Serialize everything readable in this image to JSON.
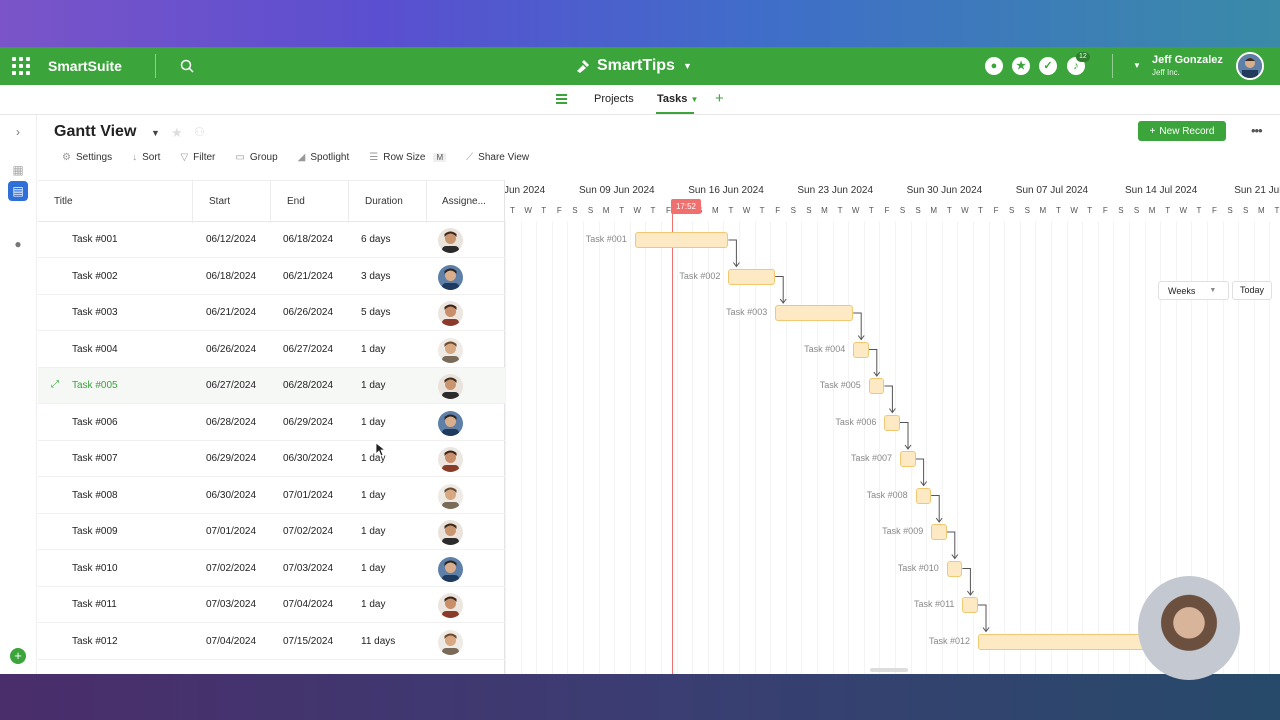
{
  "app": {
    "brand": "SmartSuite",
    "workspace": "SmartTips",
    "notification_count": "12",
    "user": {
      "name": "Jeff Gonzalez",
      "org": "Jeff Inc."
    }
  },
  "subnav": {
    "tabs": [
      {
        "label": "Projects"
      },
      {
        "label": "Tasks"
      }
    ]
  },
  "view": {
    "title": "Gantt View",
    "new_record_label": "New Record",
    "toolbar": {
      "settings": "Settings",
      "sort": "Sort",
      "filter": "Filter",
      "group": "Group",
      "spotlight": "Spotlight",
      "row_size": "Row Size",
      "row_size_value": "M",
      "share_view": "Share View"
    }
  },
  "grid": {
    "columns": [
      "Title",
      "Start",
      "End",
      "Duration",
      "Assigne..."
    ],
    "rows": [
      {
        "title": "Task #001",
        "start": "06/12/2024",
        "end": "06/18/2024",
        "duration": "6 days",
        "avatar": "a"
      },
      {
        "title": "Task #002",
        "start": "06/18/2024",
        "end": "06/21/2024",
        "duration": "3 days",
        "avatar": "b"
      },
      {
        "title": "Task #003",
        "start": "06/21/2024",
        "end": "06/26/2024",
        "duration": "5 days",
        "avatar": "c"
      },
      {
        "title": "Task #004",
        "start": "06/26/2024",
        "end": "06/27/2024",
        "duration": "1 day",
        "avatar": "d"
      },
      {
        "title": "Task #005",
        "start": "06/27/2024",
        "end": "06/28/2024",
        "duration": "1 day",
        "avatar": "a"
      },
      {
        "title": "Task #006",
        "start": "06/28/2024",
        "end": "06/29/2024",
        "duration": "1 day",
        "avatar": "b"
      },
      {
        "title": "Task #007",
        "start": "06/29/2024",
        "end": "06/30/2024",
        "duration": "1 day",
        "avatar": "c"
      },
      {
        "title": "Task #008",
        "start": "06/30/2024",
        "end": "07/01/2024",
        "duration": "1 day",
        "avatar": "d"
      },
      {
        "title": "Task #009",
        "start": "07/01/2024",
        "end": "07/02/2024",
        "duration": "1 day",
        "avatar": "a"
      },
      {
        "title": "Task #010",
        "start": "07/02/2024",
        "end": "07/03/2024",
        "duration": "1 day",
        "avatar": "b"
      },
      {
        "title": "Task #011",
        "start": "07/03/2024",
        "end": "07/04/2024",
        "duration": "1 day",
        "avatar": "c"
      },
      {
        "title": "Task #012",
        "start": "07/04/2024",
        "end": "07/15/2024",
        "duration": "11 days",
        "avatar": "d"
      }
    ]
  },
  "gantt": {
    "weeks": [
      "Jun 2024",
      "Sun 09 Jun 2024",
      "Sun 16 Jun 2024",
      "Sun 23 Jun 2024",
      "Sun 30 Jun 2024",
      "Sun 07 Jul 2024",
      "Sun 14 Jul 2024",
      "Sun 21 Jul 2024"
    ],
    "day_letters": [
      "S",
      "M",
      "T",
      "W",
      "T",
      "F",
      "S"
    ],
    "today_time": "17:52",
    "scale_label": "Weeks",
    "today_label": "Today"
  },
  "colors": {
    "accent": "#3ba43b",
    "today": "#f07070",
    "bar_fill": "#fde9c4",
    "bar_border": "#f0c872"
  }
}
